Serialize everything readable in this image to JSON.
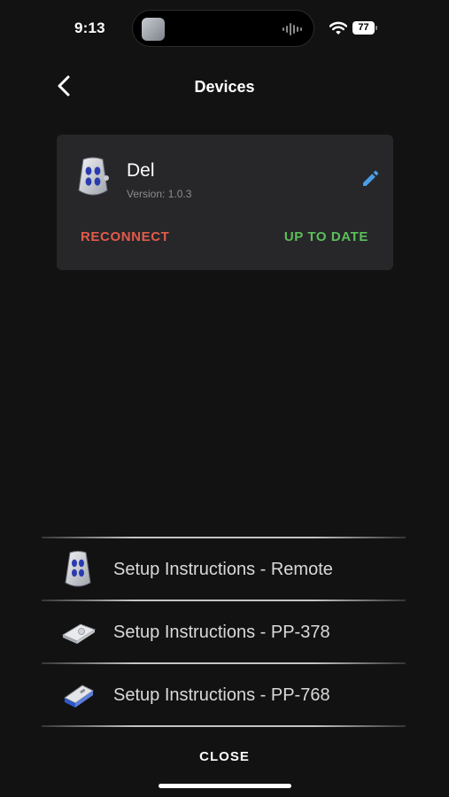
{
  "status_bar": {
    "time": "9:13",
    "battery": "77"
  },
  "header": {
    "title": "Devices",
    "back_icon": "chevron-left-icon"
  },
  "device": {
    "name": "Del",
    "version": "Version: 1.0.3",
    "reconnect_label": "RECONNECT",
    "status": "UP TO DATE",
    "edit_icon": "pencil-icon"
  },
  "setup": [
    {
      "label": "Setup Instructions - Remote",
      "icon": "remote-icon"
    },
    {
      "label": "Setup Instructions - PP-378",
      "icon": "pp378-device-icon"
    },
    {
      "label": "Setup Instructions - PP-768",
      "icon": "pp768-device-icon"
    }
  ],
  "footer": {
    "close_label": "CLOSE"
  },
  "colors": {
    "background": "#121212",
    "card": "#27272a",
    "reconnect": "#e25b4a",
    "status_ok": "#5cbf5a",
    "edit": "#4a9ee8"
  }
}
